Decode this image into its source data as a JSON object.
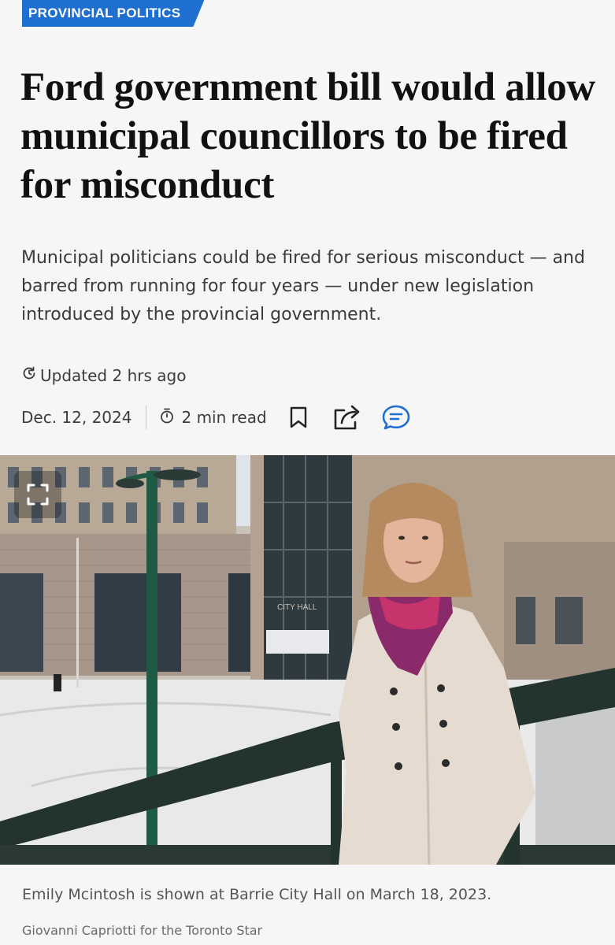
{
  "section_tag": "PROVINCIAL POLITICS",
  "headline": "Ford government bill would allow municipal councillors to be fired for misconduct",
  "dek": "Municipal politicians could be fired for serious misconduct — and barred from running for four years — under new legislation introduced by the provincial government.",
  "updated": {
    "icon": "refresh-clock-icon",
    "text": "Updated 2 hrs ago"
  },
  "meta": {
    "date": "Dec. 12, 2024",
    "read_time_icon": "stopwatch-icon",
    "read_time": "2 min read",
    "actions": [
      "bookmark-icon",
      "share-icon",
      "comments-icon"
    ]
  },
  "photo": {
    "expand_icon": "expand-icon",
    "sign_text": "CITY HALL",
    "caption": "Emily Mcintosh is shown at Barrie City Hall on March 18, 2023.",
    "credit": "Giovanni Capriotti for the Toronto Star"
  },
  "colors": {
    "tag_blue": "#1f6fd0",
    "comment_blue": "#1f6fd0"
  }
}
